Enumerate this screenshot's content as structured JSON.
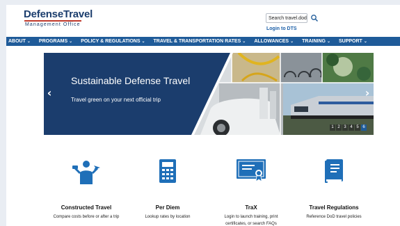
{
  "header": {
    "logo_main_1": "Defense",
    "logo_main_2": "Travel",
    "logo_sub": "Management Office",
    "search_value": "Search travel.dod",
    "login_label": "Login to DTS"
  },
  "nav": {
    "items": [
      {
        "label": "ABOUT"
      },
      {
        "label": "PROGRAMS"
      },
      {
        "label": "POLICY & REGULATIONS"
      },
      {
        "label": "TRAVEL & TRANSPORTATION RATES"
      },
      {
        "label": "ALLOWANCES"
      },
      {
        "label": "TRAINING"
      },
      {
        "label": "SUPPORT"
      }
    ]
  },
  "hero": {
    "title": "Sustainable Defense Travel",
    "subtitle": "Travel green on your next official trip",
    "slides": [
      "1",
      "2",
      "3",
      "4",
      "5",
      "6"
    ],
    "active_slide": "6"
  },
  "tiles": [
    {
      "title": "Constructed Travel",
      "desc_1": "Compare costs before or after a trip",
      "desc_2": "",
      "icon": "traveler-icon"
    },
    {
      "title": "Per Diem",
      "desc_1": "Lookup rates by location",
      "desc_2": "",
      "icon": "calculator-icon"
    },
    {
      "title": "TraX",
      "desc_1": "Login to launch training, print",
      "desc_2": "certificates, or search FAQs",
      "icon": "certificate-icon"
    },
    {
      "title": "Travel Regulations",
      "desc_1": "Reference DoD travel policies",
      "desc_2": "",
      "icon": "book-icon"
    }
  ],
  "colors": {
    "brand_blue": "#1b3d6d",
    "nav_blue": "#1f5b99",
    "icon_blue": "#1f6fb8"
  }
}
